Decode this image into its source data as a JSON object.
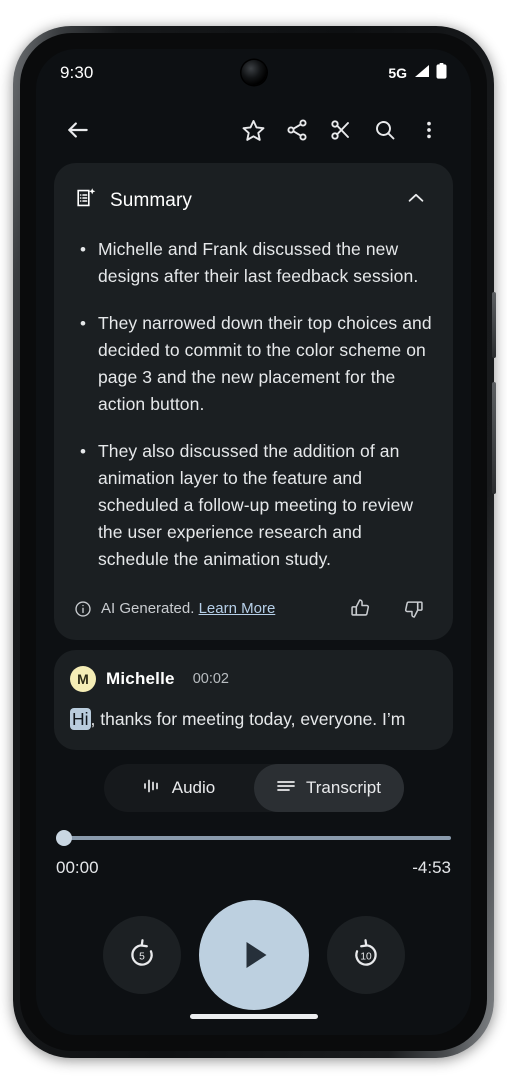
{
  "status_bar": {
    "time": "9:30",
    "network": "5G",
    "signal_icon": "signal-bars-icon",
    "battery_icon": "battery-full-icon"
  },
  "toolbar": {
    "back_icon": "back-arrow-icon",
    "star_icon": "star-outline-icon",
    "share_icon": "share-icon",
    "cut_icon": "scissors-icon",
    "search_icon": "search-icon",
    "overflow_icon": "more-vertical-icon"
  },
  "summary": {
    "icon": "summary-sparkle-icon",
    "title": "Summary",
    "collapse_icon": "chevron-up-icon",
    "bullets": [
      "Michelle and Frank discussed the new designs after their last feedback session.",
      "They narrowed down their top choices and decided to commit to the color scheme on page 3 and the new placement for the action button.",
      "They also discussed the addition of an animation layer to the feature and scheduled a follow-up meeting to review the user experience research and schedule the animation study."
    ],
    "disclaimer": {
      "info_icon": "info-circle-icon",
      "text": "AI Generated.",
      "link": "Learn More"
    },
    "feedback": {
      "thumbs_up_icon": "thumb-up-icon",
      "thumbs_down_icon": "thumb-down-icon"
    }
  },
  "transcript": {
    "avatar_initial": "M",
    "speaker": "Michelle",
    "timestamp": "00:02",
    "highlighted_word": "Hi",
    "text_rest": ", thanks for meeting today, everyone. I’m"
  },
  "segmented": {
    "audio": {
      "label": "Audio",
      "icon": "waveform-icon",
      "selected": false
    },
    "transcript": {
      "label": "Transcript",
      "icon": "list-lines-icon",
      "selected": true
    }
  },
  "player": {
    "elapsed": "00:00",
    "remaining": "-4:53",
    "progress_percent": 0,
    "replay_icon": "replay-5-icon",
    "replay_value": "5",
    "play_icon": "play-icon",
    "forward_icon": "forward-10-icon",
    "forward_value": "10"
  },
  "colors": {
    "accent": "#bdd0e0",
    "card_bg": "#1b1f22",
    "screen_bg": "#0d1013",
    "link": "#b6cfe8",
    "avatar_bg": "#f5edb6",
    "highlight_bg": "#b9ccdd"
  }
}
